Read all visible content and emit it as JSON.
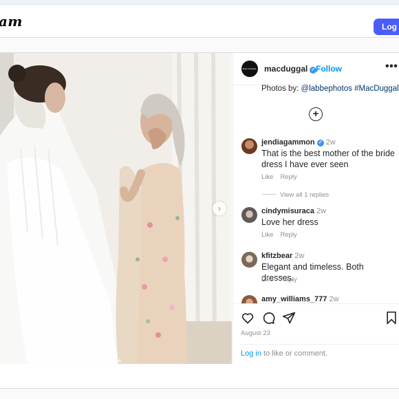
{
  "header": {
    "logo_text": "am",
    "login_label": "Log In"
  },
  "post": {
    "username": "macduggal",
    "verified_icon": "check",
    "separator": "•",
    "follow_label": "Follow",
    "more_label": "•••",
    "avatar_text": "MAC DUGGAL",
    "caption": {
      "prefix": "Photos by: ",
      "link1": "@labbephotos",
      "link2": "#MacDuggal"
    },
    "load_more_icon": "plus-circle-icon",
    "comments": [
      {
        "user": "jendiagammon",
        "verified": true,
        "time": "2w",
        "text": "That is the best mother of the bride dress I have ever seen",
        "like": "Like",
        "reply": "Reply",
        "view_replies": "View all 1 replies"
      },
      {
        "user": "cindymisuraca",
        "verified": false,
        "time": "2w",
        "text": "Love her dress",
        "like": "Like",
        "reply": "Reply"
      },
      {
        "user": "kfitzbear",
        "verified": false,
        "time": "2w",
        "text": "Elegant and timeless. Both dresses.",
        "like": "Like",
        "reply": "Reply"
      },
      {
        "user": "amy_williams_777",
        "verified": false,
        "time": "2w"
      }
    ],
    "date": "August 23",
    "login_prompt": {
      "link": "Log in",
      "rest": " to like or comment."
    },
    "carousel": {
      "count": 3,
      "active_index": 0
    }
  },
  "colors": {
    "accent": "#0095f6",
    "login_button": "#4a5df9",
    "verified": "#3897f0"
  }
}
